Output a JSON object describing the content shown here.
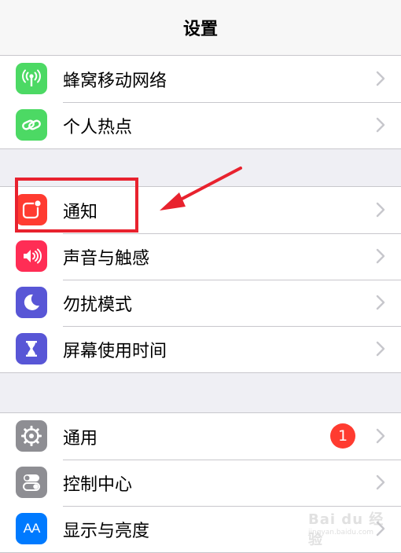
{
  "header": {
    "title": "设置"
  },
  "groups": [
    {
      "items": [
        {
          "label": "蜂窝移动网络",
          "icon": "antenna-icon",
          "color": "#4cd964"
        },
        {
          "label": "个人热点",
          "icon": "chain-link-icon",
          "color": "#4cd964"
        }
      ]
    },
    {
      "items": [
        {
          "label": "通知",
          "icon": "notification-icon",
          "color": "#ff3b30"
        },
        {
          "label": "声音与触感",
          "icon": "speaker-icon",
          "color": "#ff2d55"
        },
        {
          "label": "勿扰模式",
          "icon": "moon-icon",
          "color": "#5856d6"
        },
        {
          "label": "屏幕使用时间",
          "icon": "hourglass-icon",
          "color": "#5856d6"
        }
      ]
    },
    {
      "items": [
        {
          "label": "通用",
          "icon": "gear-icon",
          "color": "#8e8e93",
          "badge": "1"
        },
        {
          "label": "控制中心",
          "icon": "switches-icon",
          "color": "#8e8e93"
        },
        {
          "label": "显示与亮度",
          "icon": "text-size-icon",
          "color": "#007aff",
          "icon_text": "AA"
        }
      ]
    }
  ],
  "annotation": {
    "highlight_color": "#e8222e"
  },
  "watermark": {
    "logo": "Bai du 经验",
    "sub": "jingyan.baidu.com"
  }
}
